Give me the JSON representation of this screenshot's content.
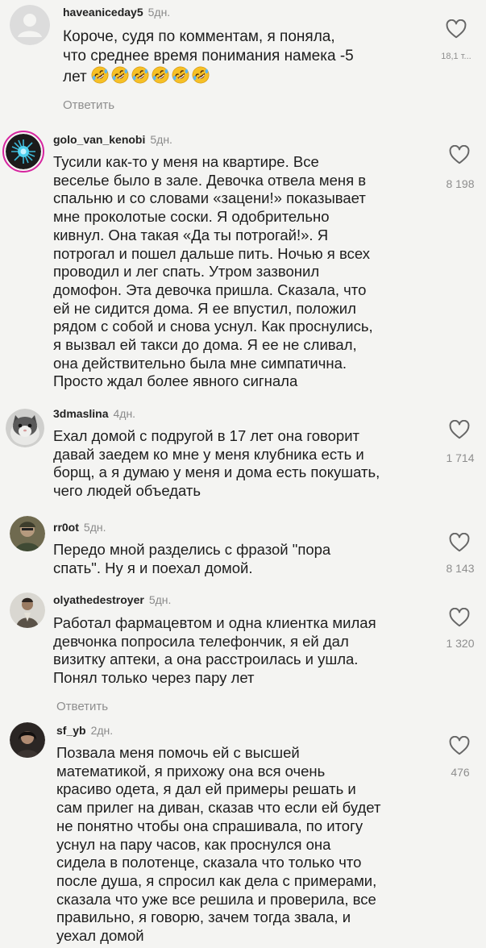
{
  "comments": [
    {
      "username": "haveaniceday5",
      "time": "5дн.",
      "text_lines": [
        "Короче, судя по комментам, я поняла,",
        "что среднее время понимания намека -5"
      ],
      "text_last": "лет",
      "emoji_name": "rolling-on-floor-laughing-emoji",
      "emoji_count": 6,
      "likes": "18,1 т...",
      "reply_label": "Ответить"
    },
    {
      "username": "golo_van_kenobi",
      "time": "5дн.",
      "text_lines": [
        "Тусили как-то у меня на квартире. Все",
        "веселье было в зале. Девочка отвела меня в",
        "спальню и со словами «зацени!» показывает",
        "мне проколотые соски. Я одобрительно",
        "кивнул. Она такая «Да ты потрогай!». Я",
        "потрогал и пошел дальше пить. Ночью я всех",
        "проводил и  лег спать. Утром зазвонил",
        "домофон. Эта девочка пришла. Сказала, что",
        "ей не сидится дома. Я ее впустил, положил",
        "рядом с собой и снова уснул. Как проснулись,",
        "я вызвал ей такси до дома. Я ее не сливал,",
        "она действительно была мне симпатична.",
        "Просто ждал более явного сигнала"
      ],
      "likes": "8 198"
    },
    {
      "username": "3dmaslina",
      "time": "4дн.",
      "text_lines": [
        "Ехал домой с подругой в 17 лет она говорит",
        "давай заедем ко мне у меня клубника есть и",
        "борщ, а я думаю у меня и дома есть покушать,",
        "чего людей объедать"
      ],
      "likes": "1 714"
    },
    {
      "username": "rr0ot",
      "time": "5дн.",
      "text_lines": [
        "Передо мной разделись с фразой \"пора",
        "спать\". Ну я и поехал домой."
      ],
      "likes": "8 143"
    },
    {
      "username": "olyathedestroyer",
      "time": "5дн.",
      "text_lines": [
        "Работал фармацевтом и одна клиентка милая",
        "девчонка попросила телефончик, я ей дал",
        "визитку аптеки, а она расстроилась и ушла.",
        "Понял только через пару лет"
      ],
      "likes": "1 320",
      "reply_label": "Ответить"
    },
    {
      "username": "sf_yb",
      "time": "2дн.",
      "text_lines": [
        "Позвала меня помочь ей с высшей",
        "математикой, я прихожу она вся очень",
        "красиво одета, я дал ей примеры решать и",
        "сам прилег на диван, сказав что если ей будет",
        "не понятно чтобы она спрашивала, по итогу",
        "уснул на пару часов, как проснулся она",
        "сидела в полотенце, сказала что только что",
        "после душа, я спросил как дела с примерами,",
        "сказала что уже все решила и проверила, все",
        "правильно, я говорю, зачем тогда звала, и",
        "уехал домой"
      ],
      "likes": "476"
    }
  ],
  "icons": {
    "like": "heart-outline-icon",
    "avatar_default": "default-avatar-icon"
  },
  "colors": {
    "background": "#f4f4f2",
    "text": "#1d1d1d",
    "muted": "#8e8e8e",
    "story_ring": "#d6249f"
  }
}
